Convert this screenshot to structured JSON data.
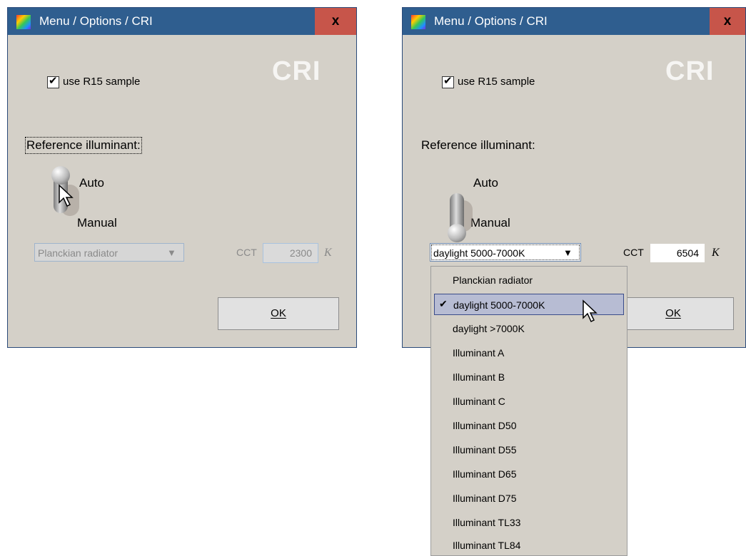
{
  "left_window": {
    "title": "Menu / Options / CRI",
    "close_label": "x",
    "logo": "CRI",
    "r15_checkbox": {
      "label": "use R15 sample",
      "checked": true
    },
    "reference_label": "Reference illuminant:",
    "toggle": {
      "on_label": "Auto",
      "off_label": "Manual",
      "state": "Auto"
    },
    "illuminant_select": {
      "value": "Planckian radiator",
      "enabled": false
    },
    "cct": {
      "label": "CCT",
      "value": "2300",
      "unit": "K",
      "enabled": false
    },
    "ok_label": "OK"
  },
  "right_window": {
    "title": "Menu / Options / CRI",
    "close_label": "x",
    "logo": "CRI",
    "r15_checkbox": {
      "label": "use R15 sample",
      "checked": true
    },
    "reference_label": "Reference illuminant:",
    "toggle": {
      "on_label": "Auto",
      "off_label": "Manual",
      "state": "Manual"
    },
    "illuminant_select": {
      "value": "daylight 5000-7000K",
      "enabled": true
    },
    "cct": {
      "label": "CCT",
      "value": "6504",
      "unit": "K",
      "enabled": true
    },
    "ok_label": "OK",
    "dropdown_options": [
      "Planckian radiator",
      "daylight 5000-7000K",
      "daylight >7000K",
      "Illuminant A",
      "Illuminant B",
      "Illuminant C",
      "Illuminant D50",
      "Illuminant D55",
      "Illuminant D65",
      "Illuminant D75",
      "Illuminant TL33",
      "Illuminant TL84"
    ],
    "dropdown_selected": "daylight 5000-7000K"
  },
  "colors": {
    "titlebar": "#2f5e8f",
    "close_button": "#c7554a",
    "dialog_bg": "#d4d0c8",
    "selection": "#b7bcd3"
  },
  "icons": {
    "app": "spectrum-icon",
    "checkmark": "check-icon",
    "arrow": "triangle-down-icon",
    "cursor": "arrow-cursor-icon"
  }
}
